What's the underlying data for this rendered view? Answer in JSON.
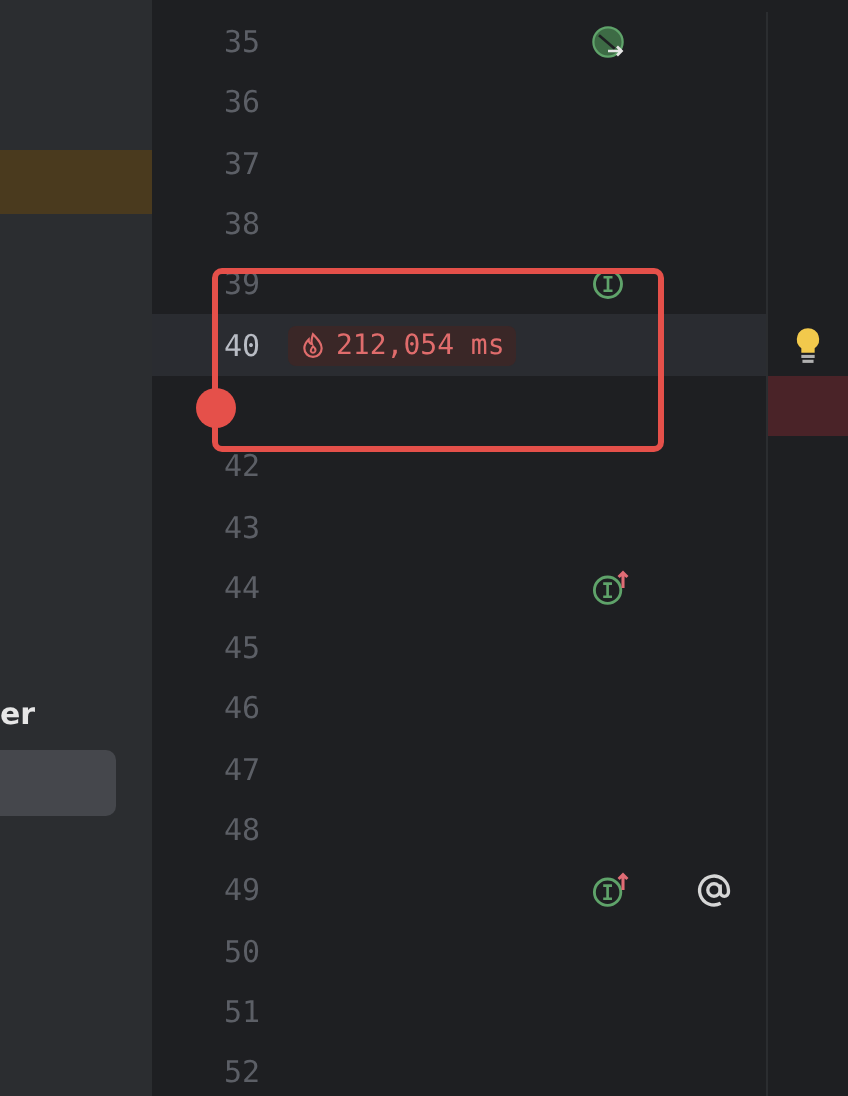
{
  "side_panel": {
    "label": "er"
  },
  "lines": [
    {
      "number": "35",
      "current": false,
      "markers": [
        {
          "kind": "run"
        }
      ]
    },
    {
      "number": "36",
      "current": false
    },
    {
      "number": "37",
      "current": false
    },
    {
      "number": "38",
      "current": false
    },
    {
      "number": "39",
      "current": false,
      "markers": [
        {
          "kind": "impl"
        }
      ]
    },
    {
      "number": "40",
      "current": true,
      "hint": "212,054 ms",
      "bulb": true
    },
    {
      "current": false,
      "error": true
    },
    {
      "number": "42",
      "current": false
    },
    {
      "number": "43",
      "current": false
    },
    {
      "number": "44",
      "current": false,
      "markers": [
        {
          "kind": "impl-up"
        }
      ]
    },
    {
      "number": "45",
      "current": false
    },
    {
      "number": "46",
      "current": false
    },
    {
      "number": "47",
      "current": false
    },
    {
      "number": "48",
      "current": false
    },
    {
      "number": "49",
      "current": false,
      "markers": [
        {
          "kind": "impl-up"
        },
        {
          "kind": "at"
        }
      ]
    },
    {
      "number": "50",
      "current": false
    },
    {
      "number": "51",
      "current": false
    },
    {
      "number": "52",
      "current": false
    }
  ]
}
